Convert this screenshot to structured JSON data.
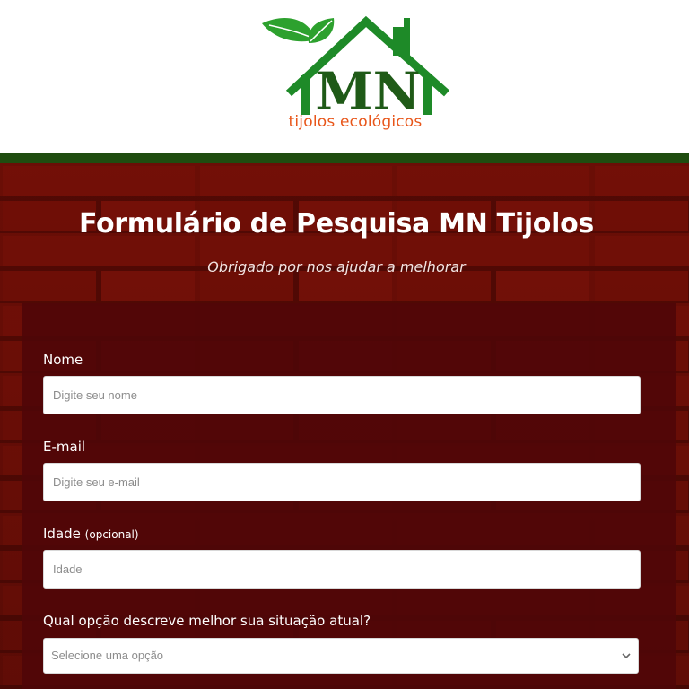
{
  "header": {
    "logo_text": "MN",
    "logo_tagline": "tijolos ecológicos"
  },
  "hero": {
    "title": "Formulário de Pesquisa MN Tijolos",
    "subtitle": "Obrigado por nos ajudar a melhorar"
  },
  "form": {
    "name": {
      "label": "Nome",
      "placeholder": "Digite seu nome",
      "value": ""
    },
    "email": {
      "label": "E-mail",
      "placeholder": "Digite seu e-mail",
      "value": ""
    },
    "age": {
      "label": "Idade",
      "optional_note": "(opcional)",
      "placeholder": "Idade",
      "value": ""
    },
    "situation": {
      "label": "Qual opção descreve melhor sua situação atual?",
      "selected": "Selecione uma opção",
      "icon": "chevron-down-icon"
    }
  },
  "colors": {
    "logo_green": "#1e8a28",
    "logo_orange": "#e8561a",
    "brand_bar": "#1f4d10",
    "brick": "#6a0d06",
    "panel": "#4e0608"
  }
}
